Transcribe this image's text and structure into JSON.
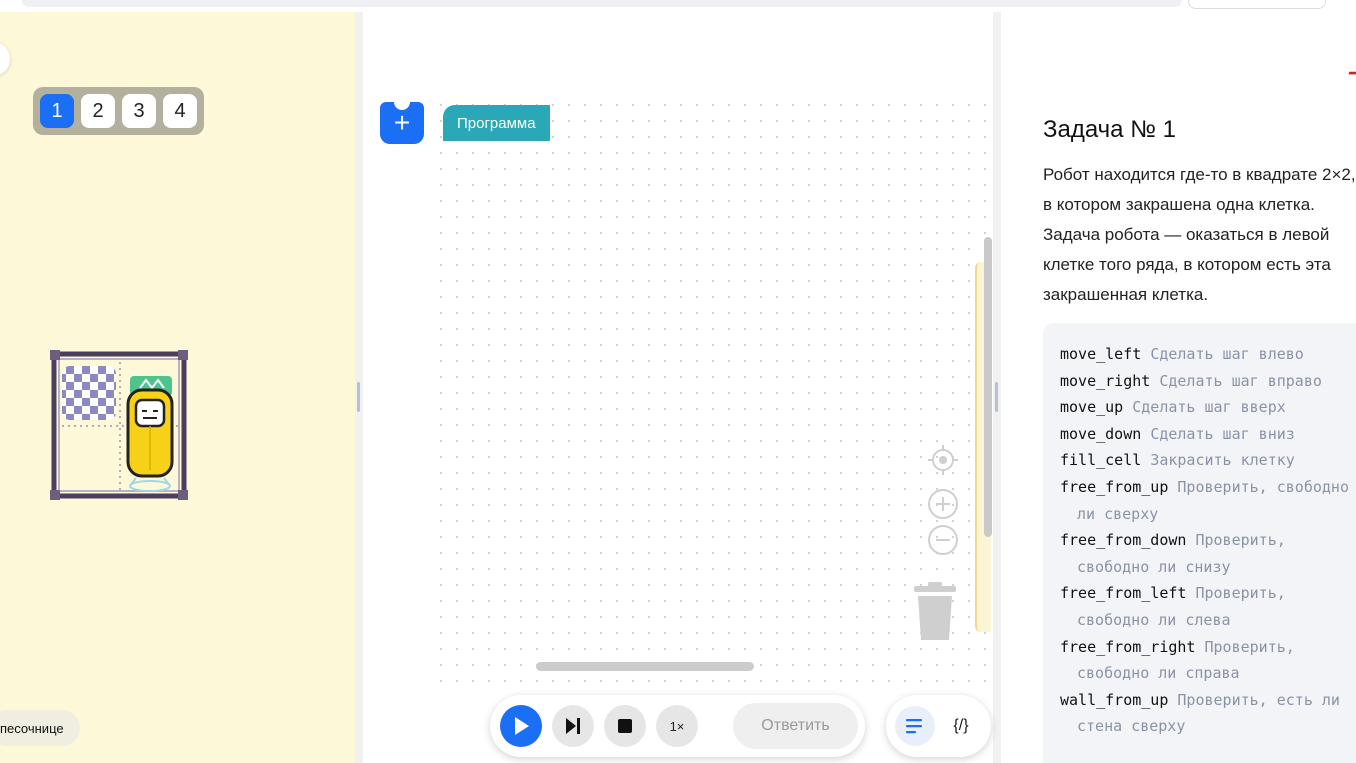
{
  "field": {
    "levels": [
      {
        "label": "1",
        "active": true
      },
      {
        "label": "2",
        "active": false
      },
      {
        "label": "3",
        "active": false
      },
      {
        "label": "4",
        "active": false
      }
    ],
    "sandbox_label": "песочнице"
  },
  "workspace": {
    "add_label": "+",
    "program_label": "Программа"
  },
  "controls": {
    "speed_label": "1×",
    "answer_label": "Ответить",
    "code_mode_label": "{/}"
  },
  "task": {
    "title": "Задача № 1",
    "description": "Робот находится где-то в квадрате 2×2, в котором закрашена одна клетка. Задача робота — оказаться в левой клетке того ряда, в котором есть эта закрашенная клетка.",
    "commands": [
      {
        "name": "move_left",
        "desc": "Сделать шаг влево"
      },
      {
        "name": "move_right",
        "desc": "Сделать шаг вправо"
      },
      {
        "name": "move_up",
        "desc": "Сделать шаг вверх"
      },
      {
        "name": "move_down",
        "desc": "Сделать шаг вниз"
      },
      {
        "name": "fill_cell",
        "desc": "Закрасить клетку"
      },
      {
        "name": "free_from_up",
        "desc": "Проверить, свободно ли сверху"
      },
      {
        "name": "free_from_down",
        "desc": "Проверить, свободно ли снизу"
      },
      {
        "name": "free_from_left",
        "desc": "Проверить, свободно ли слева"
      },
      {
        "name": "free_from_right",
        "desc": "Проверить, свободно ли справа"
      },
      {
        "name": "wall_from_up",
        "desc": "Проверить, есть ли стена сверху"
      }
    ]
  },
  "colors": {
    "accent": "#1a6ff4",
    "program_block": "#2aa8b8",
    "field_bg": "#fdf8d8",
    "robot": "#f7d117"
  }
}
